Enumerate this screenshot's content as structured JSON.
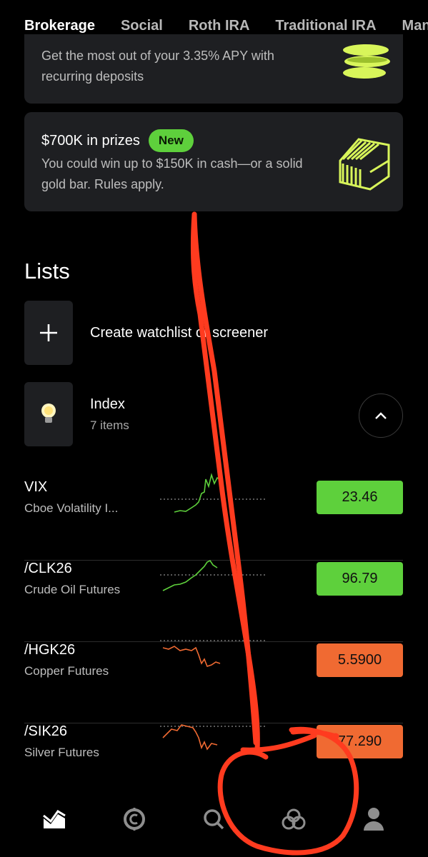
{
  "tabs": [
    "Brokerage",
    "Social",
    "Roth IRA",
    "Traditional IRA",
    "Man"
  ],
  "promo1": {
    "text": "Get the most out of your 3.35% APY with recurring deposits"
  },
  "promo2": {
    "title": "$700K in prizes",
    "badge": "New",
    "text": "You could win up to $150K in cash—or a solid gold bar. Rules apply."
  },
  "lists": {
    "title": "Lists",
    "create_label": "Create watchlist or screener",
    "index_name": "Index",
    "index_count": "7 items"
  },
  "quotes": [
    {
      "symbol": "VIX",
      "name": "Cboe Volatility I...",
      "price": "23.46",
      "direction": "up"
    },
    {
      "symbol": "/CLK26",
      "name": "Crude Oil Futures",
      "price": "96.79",
      "direction": "up"
    },
    {
      "symbol": "/HGK26",
      "name": "Copper Futures",
      "price": "5.5900",
      "direction": "down"
    },
    {
      "symbol": "/SIK26",
      "name": "Silver Futures",
      "price": "77.290",
      "direction": "down"
    }
  ],
  "nav": [
    "chart-icon",
    "crypto-icon",
    "search-icon",
    "rings-icon",
    "profile-icon"
  ],
  "colors": {
    "up": "#5ed03c",
    "down": "#f06a32",
    "annotation": "#ff3b1f"
  }
}
